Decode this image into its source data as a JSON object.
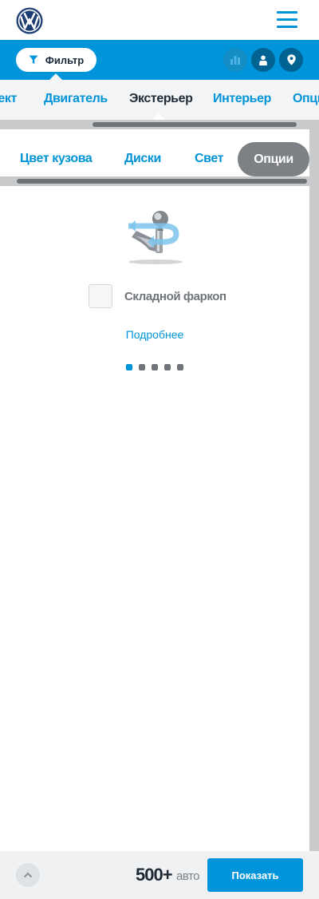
{
  "header": {
    "logo_icon": "volkswagen-logo-icon",
    "menu_icon": "hamburger-menu-icon"
  },
  "filter_bar": {
    "filter_label": "Фильтр",
    "filter_icon": "funnel-icon",
    "buttons": [
      "bar-chart-icon",
      "user-icon",
      "location-pin-icon"
    ],
    "accent_color": "#0095db"
  },
  "tabs": {
    "items": [
      "ьект",
      "Двигатель",
      "Экстерьер",
      "Интерьер",
      "Опции"
    ],
    "active": "Экстерьер"
  },
  "subtabs": {
    "items": [
      "Цвет кузова",
      "Диски",
      "Свет",
      "Опции"
    ],
    "active": "Опции"
  },
  "option": {
    "label": "Складной фаркоп",
    "checked": false,
    "more_link": "Подробнее",
    "image_icon": "tow-hitch-icon"
  },
  "carousel": {
    "pages": 5,
    "active_page": 1
  },
  "footer": {
    "count": "500+",
    "count_unit": "авто",
    "show_label": "Показать",
    "up_icon": "chevron-up-icon"
  }
}
